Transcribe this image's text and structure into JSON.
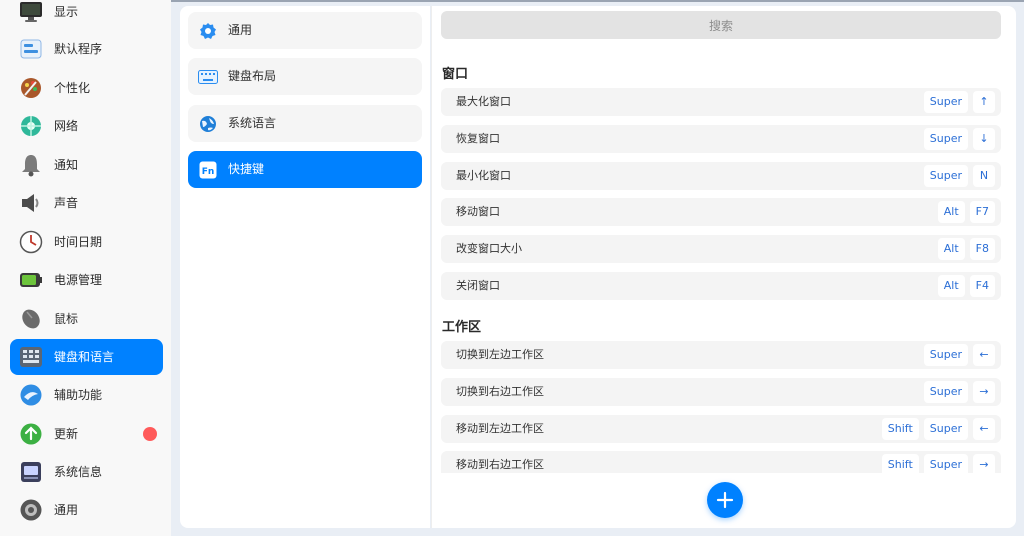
{
  "sidebar": {
    "items": [
      {
        "label": "显示",
        "icon": "display-icon"
      },
      {
        "label": "默认程序",
        "icon": "default-apps-icon"
      },
      {
        "label": "个性化",
        "icon": "personalization-icon"
      },
      {
        "label": "网络",
        "icon": "network-icon"
      },
      {
        "label": "通知",
        "icon": "bell-icon"
      },
      {
        "label": "声音",
        "icon": "speaker-icon"
      },
      {
        "label": "时间日期",
        "icon": "clock-icon"
      },
      {
        "label": "电源管理",
        "icon": "battery-icon"
      },
      {
        "label": "鼠标",
        "icon": "mouse-icon"
      },
      {
        "label": "键盘和语言",
        "icon": "keyboard-icon",
        "active": true
      },
      {
        "label": "辅助功能",
        "icon": "accessibility-icon"
      },
      {
        "label": "更新",
        "icon": "update-icon",
        "badge": true
      },
      {
        "label": "系统信息",
        "icon": "system-info-icon"
      },
      {
        "label": "通用",
        "icon": "general-icon"
      }
    ]
  },
  "subnav": {
    "items": [
      {
        "label": "通用",
        "icon": "gear-icon"
      },
      {
        "label": "键盘布局",
        "icon": "keyboard-layout-icon"
      },
      {
        "label": "系统语言",
        "icon": "globe-icon"
      },
      {
        "label": "快捷键",
        "icon": "fn-key-icon",
        "active": true
      }
    ]
  },
  "search": {
    "placeholder": "搜索"
  },
  "sections": {
    "window": {
      "title": "窗口",
      "rows": [
        {
          "name": "最大化窗口",
          "keys": [
            "Super",
            "↑"
          ]
        },
        {
          "name": "恢复窗口",
          "keys": [
            "Super",
            "↓"
          ]
        },
        {
          "name": "最小化窗口",
          "keys": [
            "Super",
            "N"
          ]
        },
        {
          "name": "移动窗口",
          "keys": [
            "Alt",
            "F7"
          ]
        },
        {
          "name": "改变窗口大小",
          "keys": [
            "Alt",
            "F8"
          ]
        },
        {
          "name": "关闭窗口",
          "keys": [
            "Alt",
            "F4"
          ]
        }
      ]
    },
    "workspace": {
      "title": "工作区",
      "rows": [
        {
          "name": "切换到左边工作区",
          "keys": [
            "Super",
            "←"
          ]
        },
        {
          "name": "切换到右边工作区",
          "keys": [
            "Super",
            "→"
          ]
        },
        {
          "name": "移动到左边工作区",
          "keys": [
            "Shift",
            "Super",
            "←"
          ]
        },
        {
          "name": "移动到右边工作区",
          "keys": [
            "Shift",
            "Super",
            "→"
          ]
        }
      ]
    }
  },
  "colors": {
    "accent": "#0081ff",
    "badge": "#ff5a5a",
    "key_text": "#2c6fd6"
  }
}
